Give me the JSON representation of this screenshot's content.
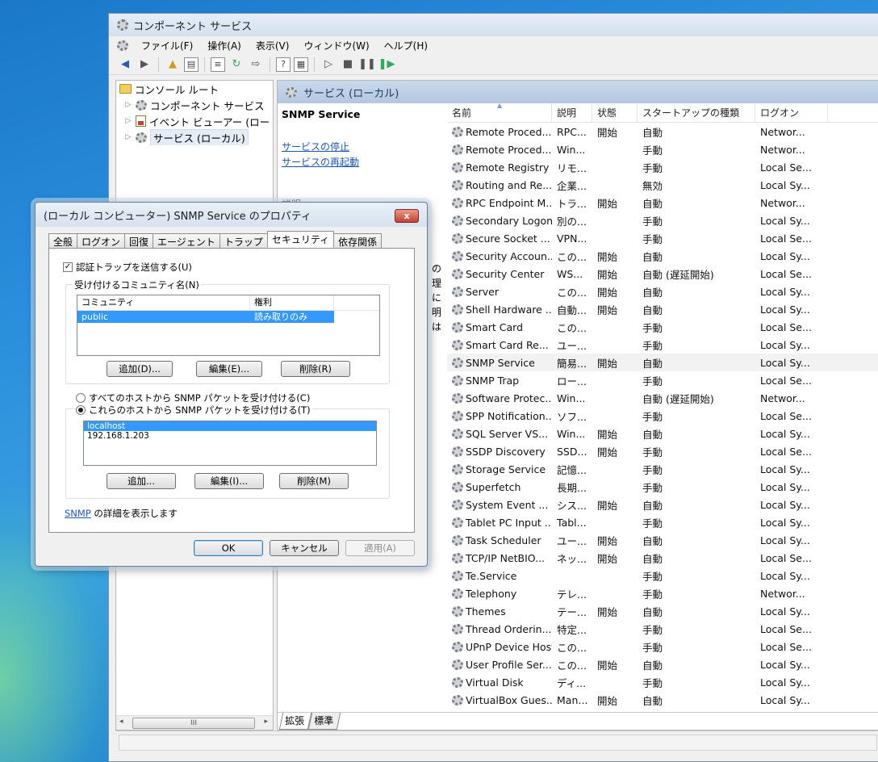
{
  "mmc": {
    "title": "コンポーネント サービス",
    "menu": [
      "ファイル(F)",
      "操作(A)",
      "表示(V)",
      "ウィンドウ(W)",
      "ヘルプ(H)"
    ],
    "tree": {
      "root": "コンソール ルート",
      "items": [
        "コンポーネント サービス",
        "イベント ビューアー (ロー",
        "サービス (ローカル)"
      ]
    },
    "scroll_label": "III",
    "services_header": "サービス (ローカル)",
    "detail": {
      "service_title": "SNMP Service",
      "stop_link": "サービスの停止",
      "restart_link": "サービスの再起動",
      "desc_fragment": "説明",
      "right_fragments": [
        "の",
        "理",
        "に",
        "明",
        "は"
      ]
    },
    "columns": [
      "名前",
      "説明",
      "状態",
      "スタートアップの種類",
      "ログオン"
    ],
    "rows": [
      {
        "name": "Remote Proced...",
        "desc": "RPC...",
        "state": "開始",
        "startup": "自動",
        "logon": "Networ..."
      },
      {
        "name": "Remote Proced...",
        "desc": "Win...",
        "state": "",
        "startup": "手動",
        "logon": "Networ..."
      },
      {
        "name": "Remote Registry",
        "desc": "リモ...",
        "state": "",
        "startup": "手動",
        "logon": "Local Se..."
      },
      {
        "name": "Routing and Re...",
        "desc": "企業...",
        "state": "",
        "startup": "無効",
        "logon": "Local Sy..."
      },
      {
        "name": "RPC Endpoint M...",
        "desc": "トラ...",
        "state": "開始",
        "startup": "自動",
        "logon": "Networ..."
      },
      {
        "name": "Secondary Logon",
        "desc": "別の...",
        "state": "",
        "startup": "手動",
        "logon": "Local Sy..."
      },
      {
        "name": "Secure Socket ...",
        "desc": "VPN...",
        "state": "",
        "startup": "手動",
        "logon": "Local Se..."
      },
      {
        "name": "Security Accoun...",
        "desc": "この...",
        "state": "開始",
        "startup": "自動",
        "logon": "Local Sy..."
      },
      {
        "name": "Security Center",
        "desc": "WS...",
        "state": "開始",
        "startup": "自動 (遅延開始)",
        "logon": "Local Se..."
      },
      {
        "name": "Server",
        "desc": "この...",
        "state": "開始",
        "startup": "自動",
        "logon": "Local Sy..."
      },
      {
        "name": "Shell Hardware ...",
        "desc": "自動...",
        "state": "開始",
        "startup": "自動",
        "logon": "Local Sy..."
      },
      {
        "name": "Smart Card",
        "desc": "この...",
        "state": "",
        "startup": "手動",
        "logon": "Local Se..."
      },
      {
        "name": "Smart Card Re...",
        "desc": "ユー...",
        "state": "",
        "startup": "手動",
        "logon": "Local Sy..."
      },
      {
        "name": "SNMP Service",
        "desc": "簡易...",
        "state": "開始",
        "startup": "自動",
        "logon": "Local Sy..."
      },
      {
        "name": "SNMP Trap",
        "desc": "ロー...",
        "state": "",
        "startup": "手動",
        "logon": "Local Se..."
      },
      {
        "name": "Software Protec...",
        "desc": "Win...",
        "state": "",
        "startup": "自動 (遅延開始)",
        "logon": "Networ..."
      },
      {
        "name": "SPP Notification...",
        "desc": "ソフ...",
        "state": "",
        "startup": "手動",
        "logon": "Local Se..."
      },
      {
        "name": "SQL Server VS...",
        "desc": "Win...",
        "state": "開始",
        "startup": "自動",
        "logon": "Local Sy..."
      },
      {
        "name": "SSDP Discovery",
        "desc": "SSD...",
        "state": "開始",
        "startup": "手動",
        "logon": "Local Se..."
      },
      {
        "name": "Storage Service",
        "desc": "記憶...",
        "state": "",
        "startup": "手動",
        "logon": "Local Sy..."
      },
      {
        "name": "Superfetch",
        "desc": "長期...",
        "state": "",
        "startup": "手動",
        "logon": "Local Sy..."
      },
      {
        "name": "System Event ...",
        "desc": "シス...",
        "state": "開始",
        "startup": "自動",
        "logon": "Local Sy..."
      },
      {
        "name": "Tablet PC Input ...",
        "desc": "Tabl...",
        "state": "",
        "startup": "手動",
        "logon": "Local Sy..."
      },
      {
        "name": "Task Scheduler",
        "desc": "ユー...",
        "state": "開始",
        "startup": "自動",
        "logon": "Local Sy..."
      },
      {
        "name": "TCP/IP NetBIO...",
        "desc": "ネッ...",
        "state": "開始",
        "startup": "自動",
        "logon": "Local Se..."
      },
      {
        "name": "Te.Service",
        "desc": "",
        "state": "",
        "startup": "手動",
        "logon": "Local Sy..."
      },
      {
        "name": "Telephony",
        "desc": "テレ...",
        "state": "",
        "startup": "手動",
        "logon": "Networ..."
      },
      {
        "name": "Themes",
        "desc": "テー...",
        "state": "開始",
        "startup": "自動",
        "logon": "Local Sy..."
      },
      {
        "name": "Thread Orderin...",
        "desc": "特定...",
        "state": "",
        "startup": "手動",
        "logon": "Local Se..."
      },
      {
        "name": "UPnP Device Host",
        "desc": "この...",
        "state": "",
        "startup": "手動",
        "logon": "Local Se..."
      },
      {
        "name": "User Profile Ser...",
        "desc": "この...",
        "state": "開始",
        "startup": "自動",
        "logon": "Local Sy..."
      },
      {
        "name": "Virtual Disk",
        "desc": "ディ...",
        "state": "",
        "startup": "手動",
        "logon": "Local Sy..."
      },
      {
        "name": "VirtualBox Gues...",
        "desc": "Man...",
        "state": "開始",
        "startup": "自動",
        "logon": "Local Sy..."
      }
    ],
    "highlighted_row": "SNMP Service",
    "bottom_tabs": [
      "拡張",
      "標準"
    ]
  },
  "dialog": {
    "title": "(ローカル コンピューター) SNMP Service のプロパティ",
    "close_label": "x",
    "tabs": [
      "全般",
      "ログオン",
      "回復",
      "エージェント",
      "トラップ",
      "セキュリティ",
      "依存関係"
    ],
    "active_tab": "セキュリティ",
    "send_trap_label": "認証トラップを送信する(U)",
    "send_trap_checked": true,
    "community_group_label": "受け付けるコミュニティ名(N)",
    "community_columns": [
      "コミュニティ",
      "権利"
    ],
    "communities": [
      {
        "name": "public",
        "rights": "読み取りのみ"
      }
    ],
    "community_buttons": [
      "追加(D)...",
      "編集(E)...",
      "削除(R)"
    ],
    "radio_all_hosts": "すべてのホストから SNMP パケットを受け付ける(C)",
    "radio_these_hosts": "これらのホストから SNMP パケットを受け付ける(T)",
    "selected_radio": "these_hosts",
    "hosts": [
      "localhost",
      "192.168.1.203"
    ],
    "host_buttons": [
      "追加...",
      "編集(I)...",
      "削除(M)"
    ],
    "snmp_link": "SNMP",
    "snmp_link_suffix": " の詳細を表示します",
    "ok": "OK",
    "cancel": "キャンセル",
    "apply": "適用(A)"
  }
}
